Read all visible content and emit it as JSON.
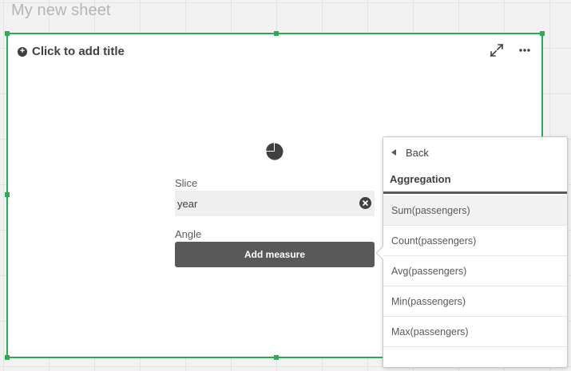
{
  "sheet": {
    "title": "My new sheet"
  },
  "chart_object": {
    "add_title": "Click to add title",
    "dimension": {
      "label": "Slice",
      "value": "year"
    },
    "measure": {
      "label": "Angle",
      "button_label": "Add measure"
    },
    "icons": {
      "add": "plus-circle-icon",
      "expand": "expand-icon",
      "more": "more-icon",
      "chart_type": "pie-chart-icon",
      "clear": "clear-icon"
    }
  },
  "popover": {
    "back_label": "Back",
    "section_header": "Aggregation",
    "items": [
      {
        "label": "Sum(passengers)",
        "selected": true
      },
      {
        "label": "Count(passengers)"
      },
      {
        "label": "Avg(passengers)"
      },
      {
        "label": "Min(passengers)"
      },
      {
        "label": "Max(passengers)"
      }
    ]
  },
  "colors": {
    "selection_border": "#2bac54",
    "button_bg": "#595959"
  }
}
